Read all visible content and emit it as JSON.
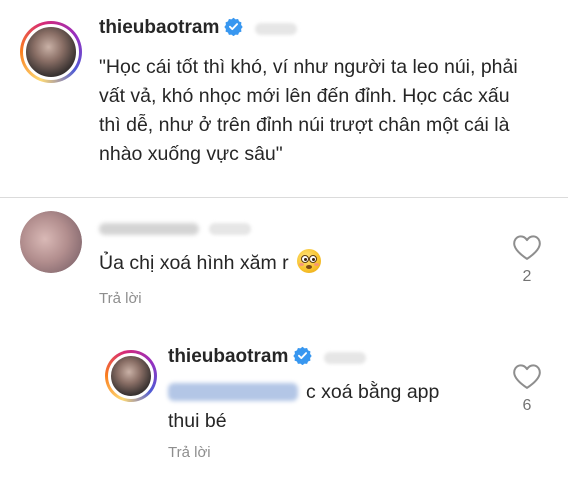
{
  "post": {
    "username": "thieubaotram",
    "caption": "\"Học cái tốt thì khó, ví như người ta leo núi, phải vất vả, khó nhọc mới lên đến đỉnh. Học các xấu thì dễ, như ở trên đỉnh núi trượt chân một cái là nhào xuống vực sâu\""
  },
  "comments": [
    {
      "text": "Ủa chị xoá hình xăm r",
      "emoji": "flushed-face-emoji",
      "reply_label": "Trả lời",
      "likes": "2"
    }
  ],
  "reply": {
    "username": "thieubaotram",
    "text": "c xoá bằng app thui bé",
    "reply_label": "Trả lời",
    "likes": "6"
  },
  "colors": {
    "verified": "#3897f0",
    "muted": "#8e8e8e",
    "text": "#262626",
    "divider": "#dbdbdb"
  }
}
